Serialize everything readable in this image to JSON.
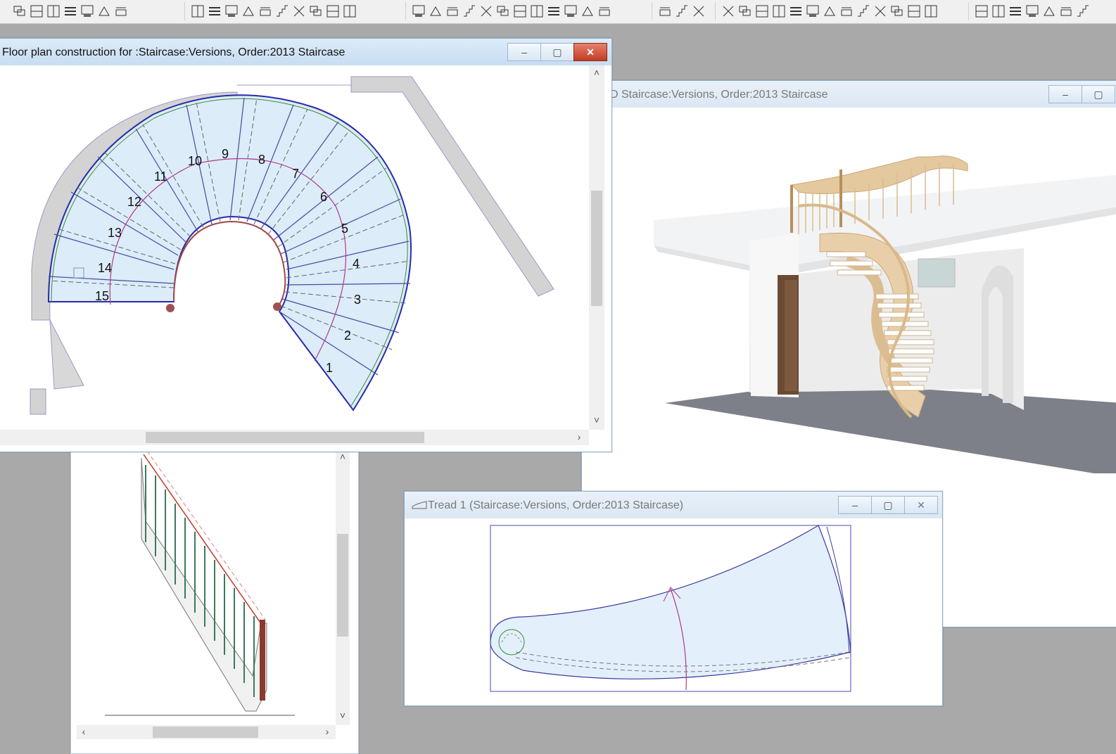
{
  "windows": {
    "view3d": {
      "title": "D Staircase:Versions, Order:2013 Staircase"
    },
    "floorplan": {
      "title": "Floor plan construction for :Staircase:Versions, Order:2013 Staircase",
      "step_numbers": [
        "1",
        "2",
        "3",
        "4",
        "5",
        "6",
        "7",
        "8",
        "9",
        "10",
        "11",
        "12",
        "13",
        "14",
        "15"
      ]
    },
    "tread": {
      "title": "Tread 1 (Staircase:Versions, Order:2013 Staircase)"
    }
  },
  "controls": {
    "minimize": "–",
    "maximize": "▢",
    "close": "✕"
  },
  "scroll_arrows": {
    "up": "˄",
    "down": "˅",
    "left": "‹",
    "right": "›"
  },
  "icons": {
    "toolbar_group1": [
      "window-cascade-icon",
      "window-split-horizontal-icon",
      "window-split-vertical-icon",
      "window-list-icon",
      "window-export-icon",
      "window-import-icon",
      "window-close-icon"
    ],
    "toolbar_group2": [
      "stair-plan-icon",
      "stair-elevation-icon",
      "stair-section-icon",
      "stair-3d-icon",
      "stair-render-icon",
      "stair-hidden-icon",
      "stair-shade-icon",
      "stair-print-icon",
      "stair-plot-icon",
      "stair-car-icon"
    ],
    "toolbar_group3": [
      "dimension-icon",
      "frame-icon",
      "balustrade-icon",
      "handrail-icon",
      "rail-icon",
      "tread-icon",
      "riser-icon",
      "stringer-icon",
      "landing-icon",
      "post-icon",
      "material-icon",
      "settings-icon"
    ],
    "toolbar_group4": [
      "snap-icon",
      "pointer-icon",
      "fly-icon"
    ],
    "toolbar_group5": [
      "view-front-icon",
      "view-back-icon",
      "view-left-icon",
      "view-right-icon",
      "move-icon",
      "rotate-icon",
      "zoom-icon",
      "view-top-icon",
      "view-bottom-icon",
      "view-iso1-icon",
      "view-iso2-icon",
      "view-iso3-icon",
      "view-iso4-icon"
    ],
    "toolbar_group6": [
      "polygon-icon",
      "angle-icon",
      "line-icon",
      "line-dashed-icon",
      "intersect-icon",
      "bisect-icon",
      "perpendicular-icon"
    ]
  }
}
